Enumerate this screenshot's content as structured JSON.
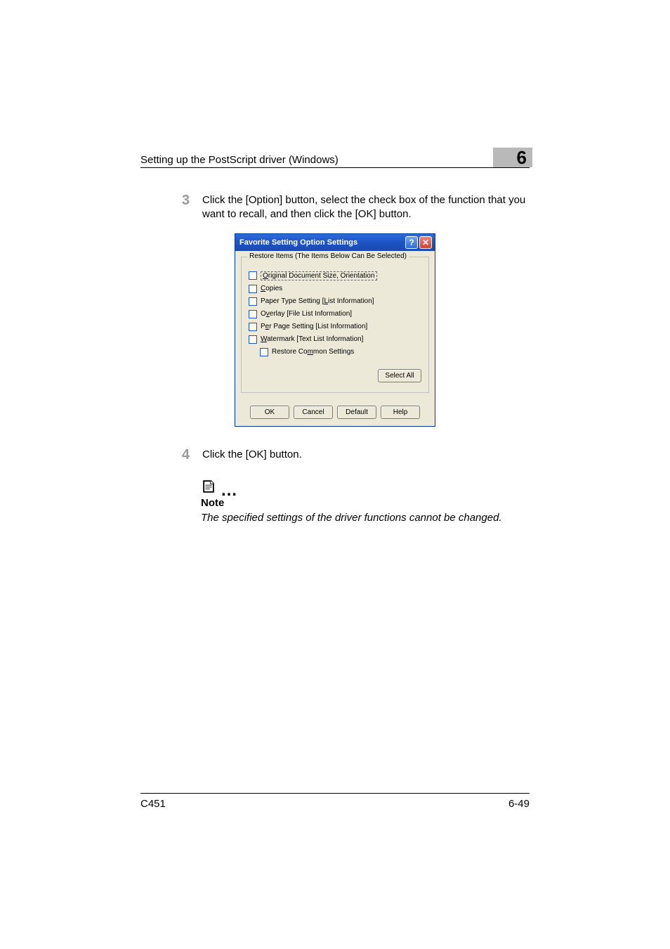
{
  "header": {
    "title": "Setting up the PostScript driver (Windows)",
    "chapter": "6"
  },
  "steps": {
    "s3": {
      "num": "3",
      "text": "Click the [Option] button, select the check box of the function that you want to recall, and then click the [OK] button."
    },
    "s4": {
      "num": "4",
      "text": "Click the [OK] button."
    }
  },
  "dialog": {
    "title": "Favorite Setting Option Settings",
    "help": "?",
    "close": "✕",
    "group_legend": "Restore Items (The Items Below Can Be Selected)",
    "items": {
      "i0": {
        "pre": "",
        "u": "O",
        "post": "riginal Document Size, Orientation"
      },
      "i1": {
        "pre": "",
        "u": "C",
        "post": "opies"
      },
      "i2": {
        "pre": "Paper Type Setting [",
        "u": "L",
        "post": "ist Information]"
      },
      "i3": {
        "pre": "O",
        "u": "v",
        "post": "erlay [File List Information]"
      },
      "i4": {
        "pre": "P",
        "u": "e",
        "post": "r Page Setting [List Information]"
      },
      "i5": {
        "pre": "",
        "u": "W",
        "post": "atermark [Text List Information]"
      },
      "i6": {
        "pre": "Restore Co",
        "u": "m",
        "post": "mon Settings"
      }
    },
    "select_all": {
      "pre": "Selec",
      "u": "t",
      "post": " All"
    },
    "buttons": {
      "ok": "OK",
      "cancel": "Cancel",
      "default": "Default",
      "help": {
        "pre": "",
        "u": "H",
        "post": "elp"
      }
    }
  },
  "note": {
    "dots": "…",
    "label": "Note",
    "text": "The specified settings of the driver functions cannot be changed."
  },
  "footer": {
    "left": "C451",
    "right": "6-49"
  }
}
